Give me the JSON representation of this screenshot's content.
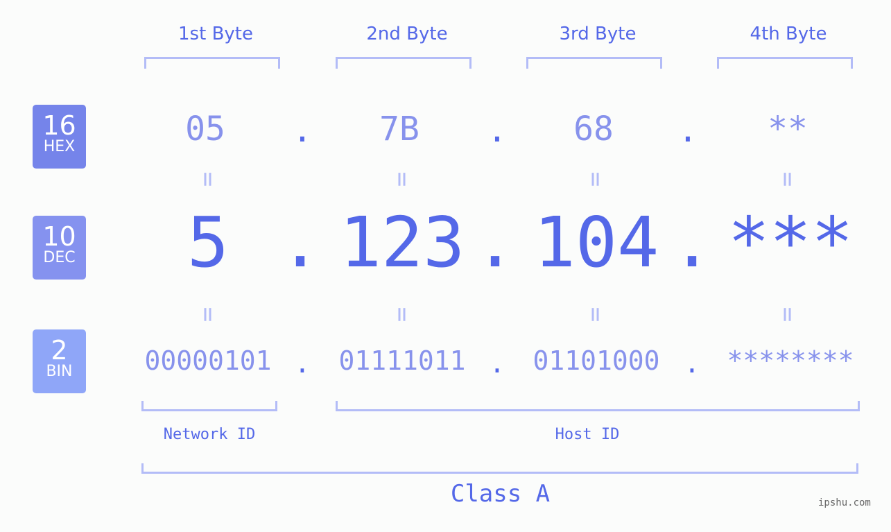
{
  "bytes": [
    {
      "label": "1st Byte",
      "hex": "05",
      "dec": "5",
      "bin": "00000101"
    },
    {
      "label": "2nd Byte",
      "hex": "7B",
      "dec": "123",
      "bin": "01111011"
    },
    {
      "label": "3rd Byte",
      "hex": "68",
      "dec": "104",
      "bin": "01101000"
    },
    {
      "label": "4th Byte",
      "hex": "**",
      "dec": "***",
      "bin": "********"
    }
  ],
  "badges": {
    "hex": {
      "num": "16",
      "label": "HEX",
      "color": "#7584ea"
    },
    "dec": {
      "num": "10",
      "label": "DEC",
      "color": "#8592ef"
    },
    "bin": {
      "num": "2",
      "label": "BIN",
      "color": "#8fa6f8"
    }
  },
  "separator": ".",
  "equals": "=",
  "network_id_label": "Network ID",
  "host_id_label": "Host ID",
  "class_label": "Class A",
  "watermark": "ipshu.com"
}
